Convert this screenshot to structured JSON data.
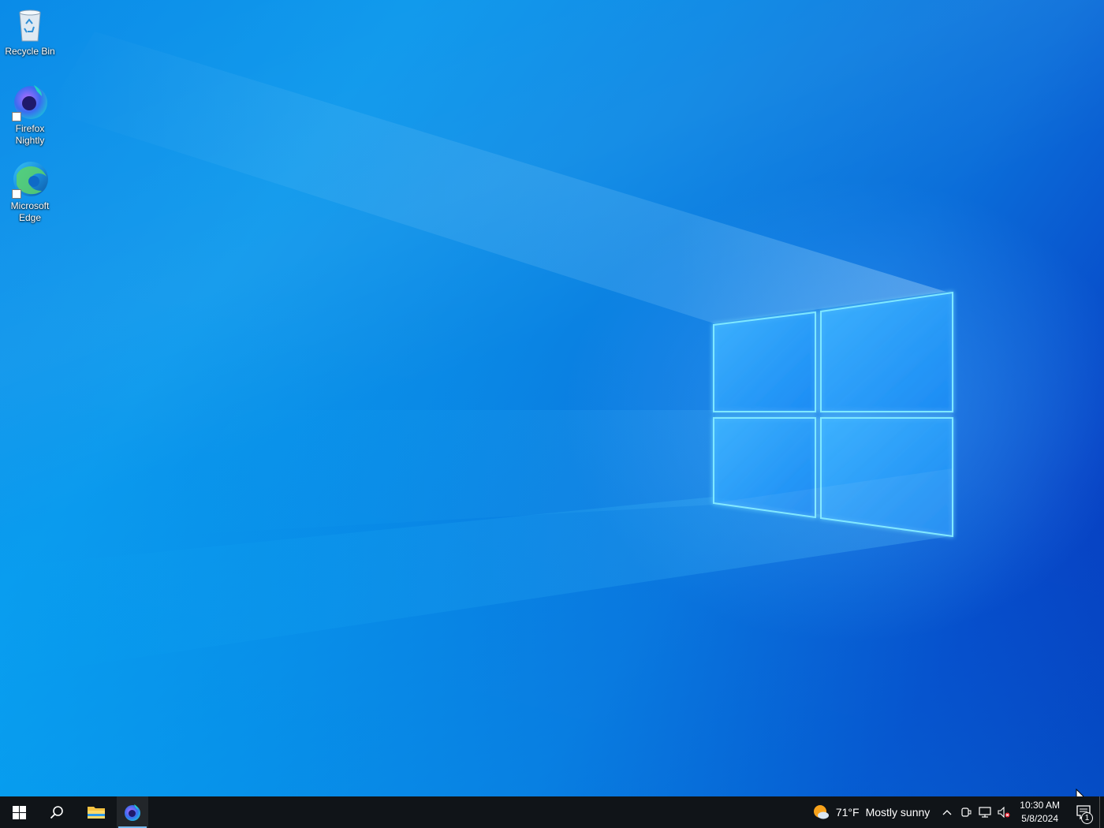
{
  "desktop": {
    "icons": [
      {
        "label": "Recycle Bin",
        "icon": "recycle-bin-icon"
      },
      {
        "label": "Firefox Nightly",
        "icon": "firefox-nightly-icon"
      },
      {
        "label": "Microsoft Edge",
        "icon": "edge-icon"
      }
    ]
  },
  "taskbar": {
    "start_icon": "windows-start-icon",
    "search_icon": "search-icon",
    "pinned": [
      {
        "name": "File Explorer",
        "icon": "folder-icon",
        "active": false
      },
      {
        "name": "Firefox Nightly",
        "icon": "firefox-nightly-icon",
        "active": true
      }
    ],
    "tray": {
      "weather": {
        "temperature": "71°F",
        "condition": "Mostly sunny",
        "icon": "partly-sunny-icon"
      },
      "icons": [
        "chevron-up-icon",
        "meet-now-icon",
        "network-icon",
        "volume-muted-icon"
      ],
      "clock": {
        "time": "10:30 AM",
        "date": "5/8/2024"
      },
      "notifications": {
        "count": "1",
        "icon": "action-center-icon"
      }
    }
  },
  "colors": {
    "taskbar_bg": "#101418",
    "active_indicator": "#76b9ed",
    "desktop_accent": "#0a86e4"
  }
}
